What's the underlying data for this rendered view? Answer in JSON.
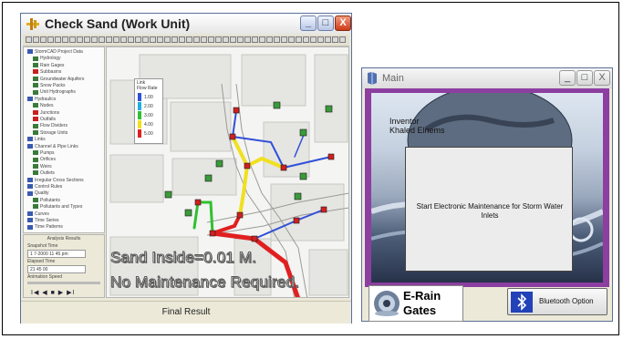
{
  "left_window": {
    "title": "Check Sand (Work Unit)",
    "minimize": "_",
    "maximize": "□",
    "close": "X",
    "tree_items": [
      {
        "label": "StormCAD Project Data",
        "kind": "blue"
      },
      {
        "label": "Hydrology",
        "kind": "green"
      },
      {
        "label": "Rain Gages",
        "kind": "green"
      },
      {
        "label": "Subbasins",
        "kind": "red"
      },
      {
        "label": "Groundwater Aquifers",
        "kind": "green"
      },
      {
        "label": "Snow Packs",
        "kind": "green"
      },
      {
        "label": "Unit Hydrographs",
        "kind": "green"
      },
      {
        "label": "Hydraulics",
        "kind": "blue"
      },
      {
        "label": "Nodes",
        "kind": "green"
      },
      {
        "label": "Junctions",
        "kind": "red"
      },
      {
        "label": "Outfalls",
        "kind": "red"
      },
      {
        "label": "Flow Dividers",
        "kind": "green"
      },
      {
        "label": "Storage Units",
        "kind": "green"
      },
      {
        "label": "Links",
        "kind": "blue"
      },
      {
        "label": "Channel & Pipe Links",
        "kind": "blue"
      },
      {
        "label": "Pumps",
        "kind": "green"
      },
      {
        "label": "Orifices",
        "kind": "green"
      },
      {
        "label": "Weirs",
        "kind": "green"
      },
      {
        "label": "Outlets",
        "kind": "green"
      },
      {
        "label": "Irregular Cross Sections",
        "kind": "blue"
      },
      {
        "label": "Control Rules",
        "kind": "blue"
      },
      {
        "label": "Quality",
        "kind": "blue"
      },
      {
        "label": "Pollutants",
        "kind": "green"
      },
      {
        "label": "Pollutants and Types",
        "kind": "green"
      },
      {
        "label": "Curves",
        "kind": "blue"
      },
      {
        "label": "Time Series",
        "kind": "blue"
      },
      {
        "label": "Time Patterns",
        "kind": "blue"
      }
    ],
    "analysis": {
      "header": "Analysis Results",
      "snapshot_label": "Snapshot Time",
      "snapshot_value": "1 7-2000 11 45 pm",
      "elapsed_label": "Elapsed Time",
      "elapsed_value": "21 45 00",
      "animation_label": "Animation Speed",
      "controls": "I◀ ◀ ■ ▶ ▶I"
    },
    "legend": {
      "title": "Link",
      "subtitle": "Flow Rate",
      "items": [
        {
          "label": "1.00",
          "color": "#3050d8"
        },
        {
          "label": "2.00",
          "color": "#20b0e0"
        },
        {
          "label": "3.00",
          "color": "#30c030"
        },
        {
          "label": "4.00",
          "color": "#f0e020"
        },
        {
          "label": "5.00",
          "color": "#e02020"
        }
      ]
    },
    "overlay_line1": "Sand Inside=0.01 M.",
    "overlay_line2": "No Maintenance Required.",
    "status": "Final Result"
  },
  "right_window": {
    "title": "Main",
    "minimize": "_",
    "maximize": "□",
    "close": "X",
    "inventor_label": "Inventor",
    "inventor_name": "Khaled Elnems",
    "dialog_message": "Start Electronic Maintenance for Storm Water Inlets"
  },
  "erain": {
    "line1": "E-Rain",
    "line2": "Gates"
  },
  "bluetooth": {
    "label": "Bluetooth Option"
  },
  "colors": {
    "accent_purple": "#8c3fa0",
    "pipe_red": "#e02020",
    "pipe_yellow": "#f0e020",
    "pipe_blue": "#3050d8",
    "pipe_green": "#30c030"
  }
}
